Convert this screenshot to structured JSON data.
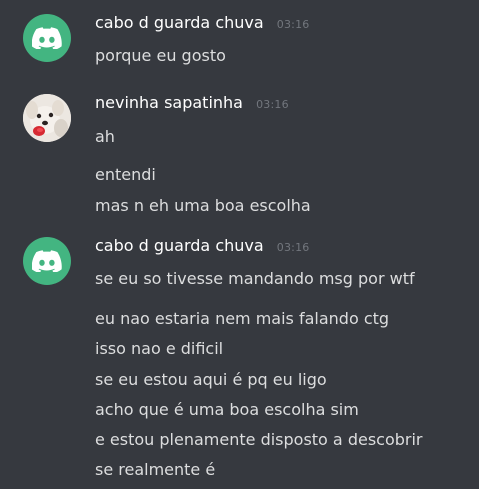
{
  "messages": [
    {
      "username": "cabo d guarda chuva",
      "timestamp": "03:16",
      "avatar_icon": "discord-logo-icon",
      "avatar_color": "#43b581",
      "lines": [
        "porque eu gosto"
      ]
    },
    {
      "username": "nevinha sapatinha",
      "timestamp": "03:16",
      "avatar_icon": "dog-photo",
      "lines": [
        "ah",
        "entendi",
        "mas n eh uma boa escolha"
      ]
    },
    {
      "username": "cabo d guarda chuva",
      "timestamp": "03:16",
      "avatar_icon": "discord-logo-icon",
      "avatar_color": "#43b581",
      "lines": [
        "se eu so tivesse mandando msg por wtf",
        "eu nao estaria nem mais falando ctg",
        "isso nao e dificil",
        "se eu estou aqui é pq eu ligo",
        "acho que é uma boa escolha sim",
        "e estou plenamente disposto a descobrir",
        "se realmente é"
      ]
    }
  ],
  "colors": {
    "background": "#36393f",
    "username": "#ffffff",
    "message_text": "#dcddde",
    "timestamp": "#72767d"
  }
}
